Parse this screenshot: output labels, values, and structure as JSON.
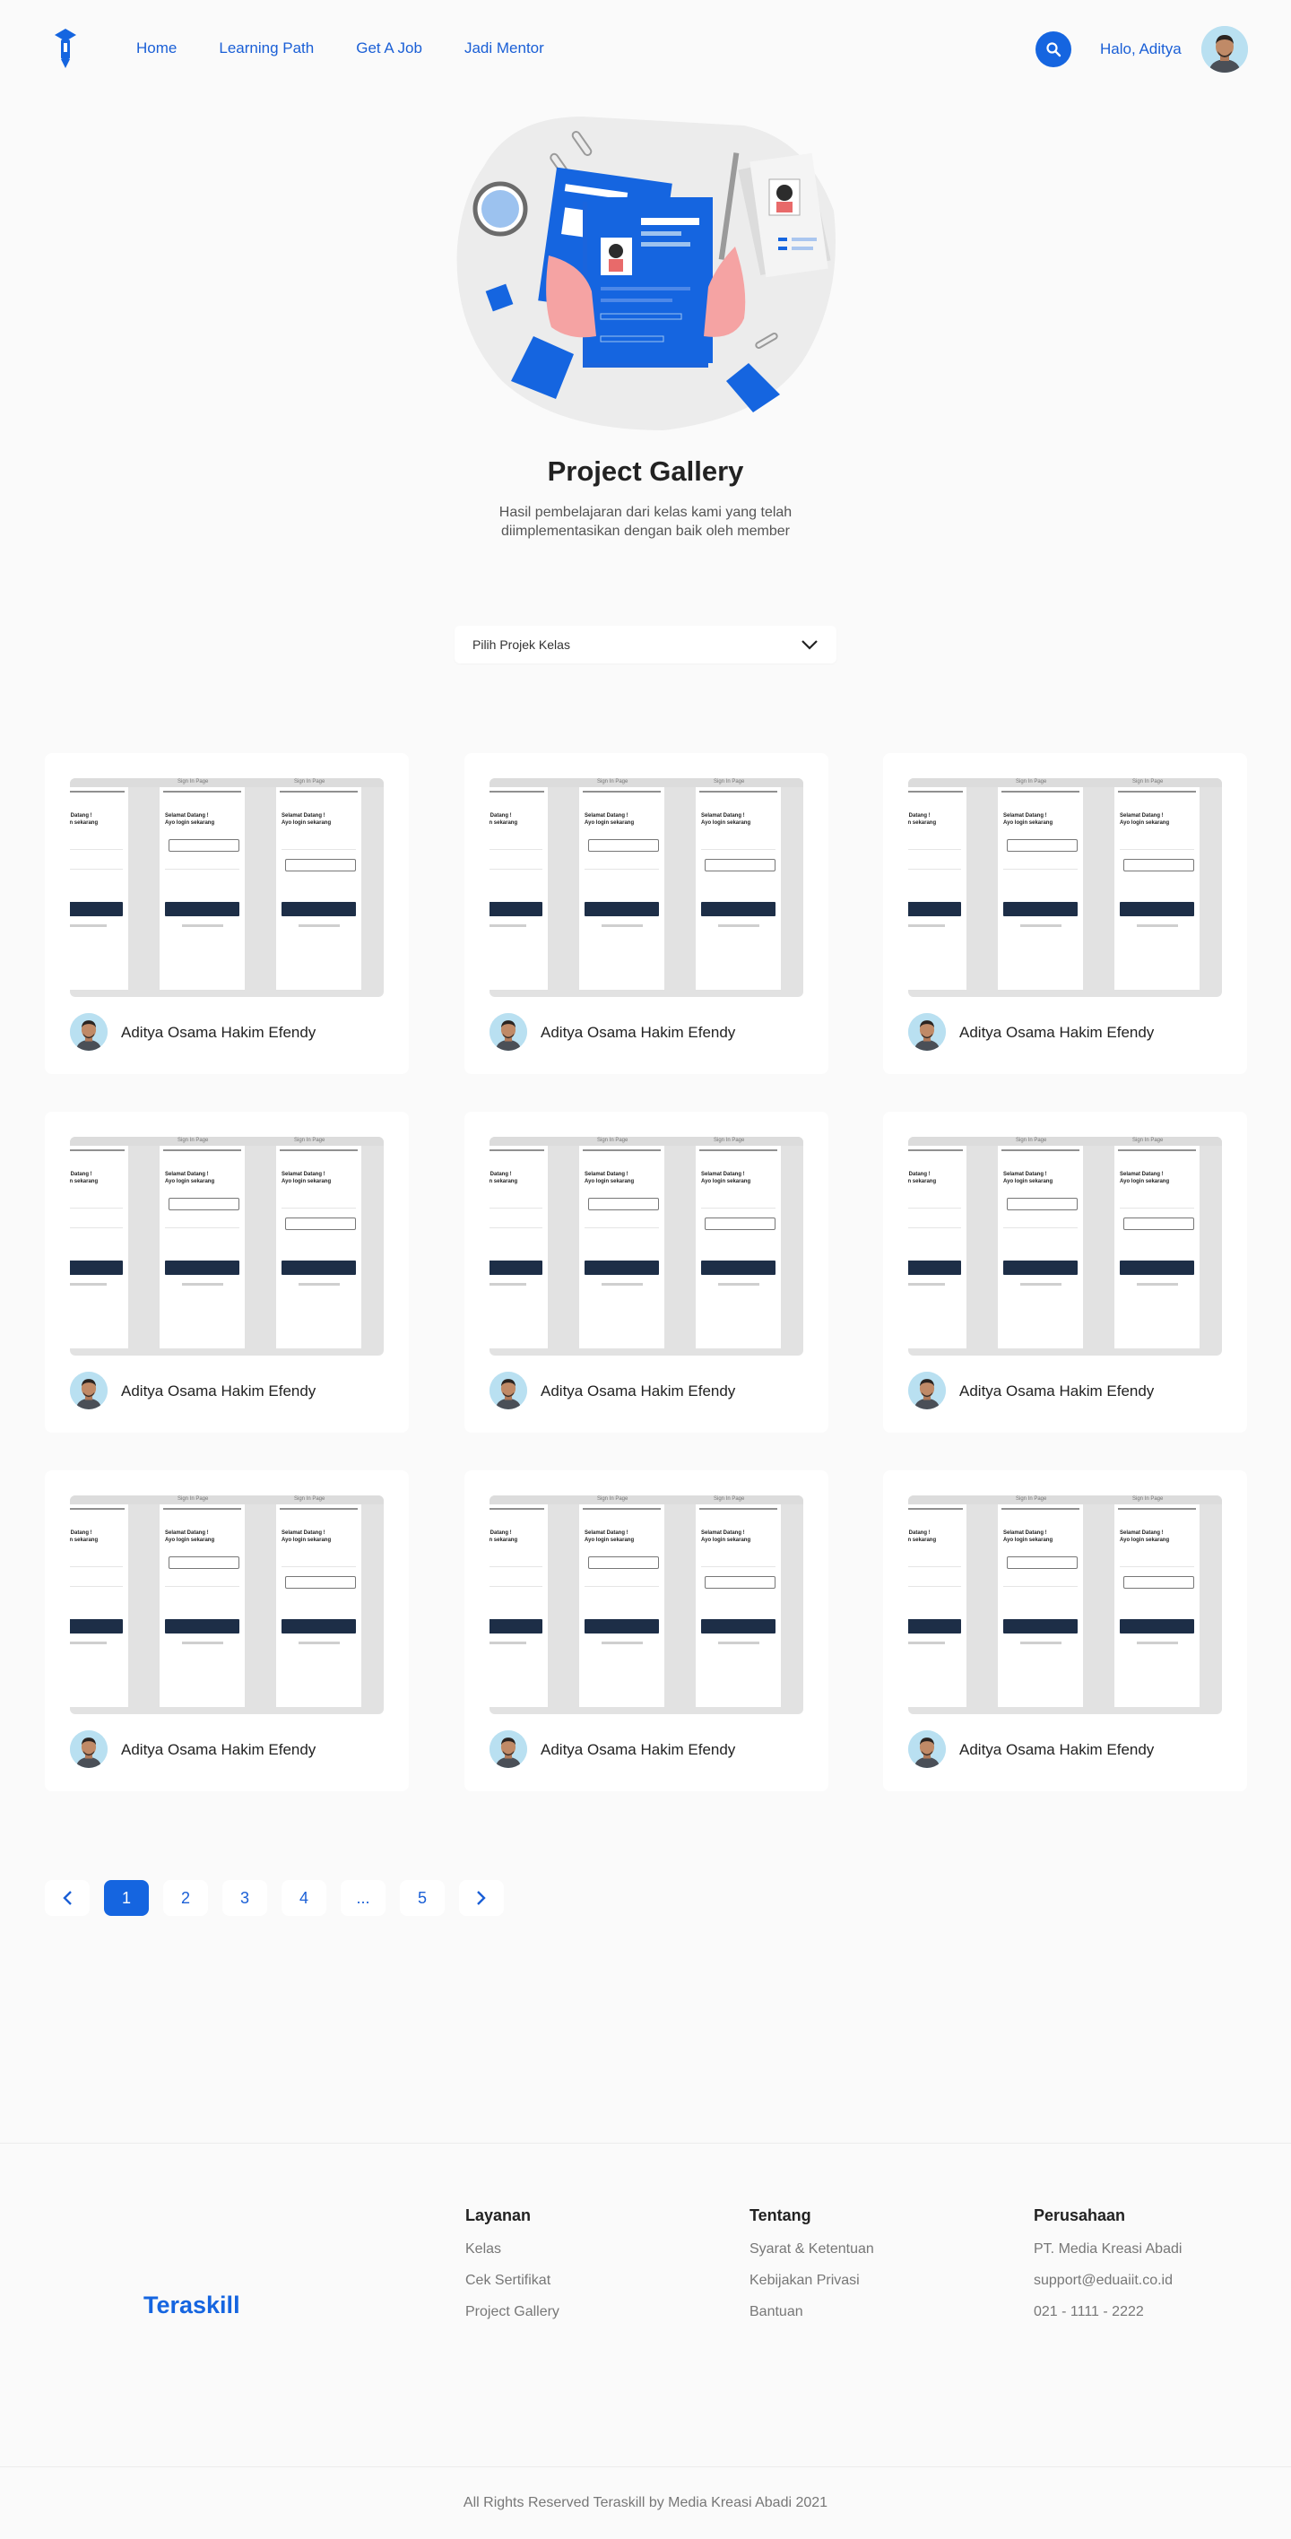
{
  "header": {
    "logo_icon": "graduation-pin-icon",
    "nav": [
      "Home",
      "Learning Path",
      "Get A Job",
      "Jadi Mentor"
    ],
    "search_icon": "search-icon",
    "greeting": "Halo, Aditya",
    "accent": "#1565e0"
  },
  "hero": {
    "title": "Project Gallery",
    "subtitle": "Hasil pembelajaran dari kelas kami yang telah diimplementasikan dengan baik oleh member"
  },
  "filter": {
    "label": "Pilih Projek Kelas",
    "icon": "chevron-down-icon"
  },
  "gallery": {
    "preview": {
      "window_label": "Sign In Page",
      "heading": "Selamat Datang !\nAyo login sekarang",
      "button": "Login"
    },
    "cards": [
      {
        "name": "Aditya Osama Hakim Efendy"
      },
      {
        "name": "Aditya Osama Hakim Efendy"
      },
      {
        "name": "Aditya Osama Hakim Efendy"
      },
      {
        "name": "Aditya Osama Hakim Efendy"
      },
      {
        "name": "Aditya Osama Hakim Efendy"
      },
      {
        "name": "Aditya Osama Hakim Efendy"
      },
      {
        "name": "Aditya Osama Hakim Efendy"
      },
      {
        "name": "Aditya Osama Hakim Efendy"
      },
      {
        "name": "Aditya Osama Hakim Efendy"
      }
    ]
  },
  "pagination": {
    "pages": [
      "1",
      "2",
      "3",
      "4",
      "...",
      "5"
    ],
    "current": "1",
    "prev_icon": "chevron-left-icon",
    "next_icon": "chevron-right-icon"
  },
  "footer": {
    "brand": "Teraskill",
    "columns": [
      {
        "title": "Layanan",
        "items": [
          "Kelas",
          "Cek Sertifikat",
          "Project Gallery"
        ]
      },
      {
        "title": "Tentang",
        "items": [
          "Syarat & Ketentuan",
          "Kebijakan Privasi",
          "Bantuan"
        ]
      },
      {
        "title": "Perusahaan",
        "items": [
          "PT. Media Kreasi Abadi",
          "support@eduaiit.co.id",
          "021 - 1111 - 2222"
        ]
      }
    ],
    "copyright": "All Rights Reserved Teraskill by Media Kreasi Abadi 2021"
  }
}
